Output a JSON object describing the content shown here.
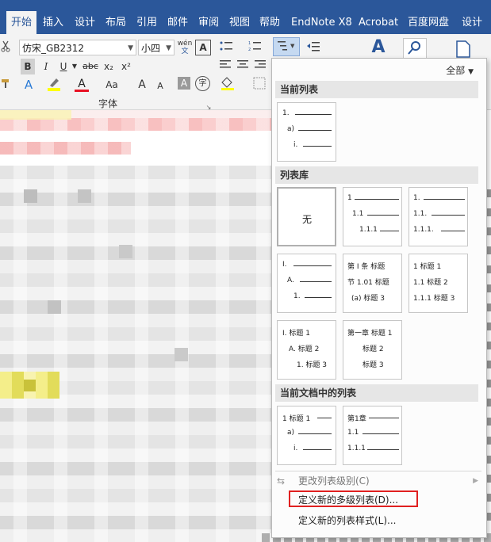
{
  "ribbon": {
    "tabs": [
      "开始",
      "插入",
      "设计",
      "布局",
      "引用",
      "邮件",
      "审阅",
      "视图",
      "帮助",
      "EndNote X8",
      "Acrobat",
      "百度网盘",
      "设计"
    ],
    "font_name": "仿宋_GB2312",
    "font_size": "小四",
    "font_group_label": "字体",
    "bold": "B",
    "italic": "I",
    "underline": "U",
    "strike": "abc",
    "subscript": "x₂",
    "superscript": "x²",
    "grow": "A",
    "shrink": "A",
    "case": "Aa",
    "phonetic": "wén",
    "char_border": "A",
    "shade": "A",
    "enclose": "字"
  },
  "dropdown": {
    "all_label": "全部",
    "section_current": "当前列表",
    "section_library": "列表库",
    "section_doc": "当前文档中的列表",
    "none_label": "无",
    "menu": {
      "change_level": "更改列表级别(C)",
      "define_new_multilevel": "定义新的多级列表(D)...",
      "define_new_style": "定义新的列表样式(L)..."
    },
    "samples": {
      "current": [
        "1.",
        "a)",
        "i."
      ],
      "lib_numeric": [
        "1",
        "1.1",
        "1.1.1"
      ],
      "lib_numeric_dot": [
        "1.",
        "1.1.",
        "1.1.1."
      ],
      "lib_roman": [
        "I.",
        "A.",
        "1."
      ],
      "lib_article": [
        "第 Ⅰ 条 标题",
        "节 1.01 标题",
        "(a) 标题 3"
      ],
      "lib_heading_num": [
        "1 标题 1",
        "1.1 标题 2",
        "1.1.1 标题 3"
      ],
      "lib_heading_roman": [
        "I. 标题 1",
        "A. 标题 2",
        "1. 标题 3"
      ],
      "lib_chapter": [
        "第一章 标题 1",
        "标题 2",
        "标题 3"
      ],
      "doc_a": [
        "1 标题 1",
        "a)",
        "i."
      ],
      "doc_b": [
        "第1章",
        "1.1",
        "1.1.1"
      ]
    }
  }
}
